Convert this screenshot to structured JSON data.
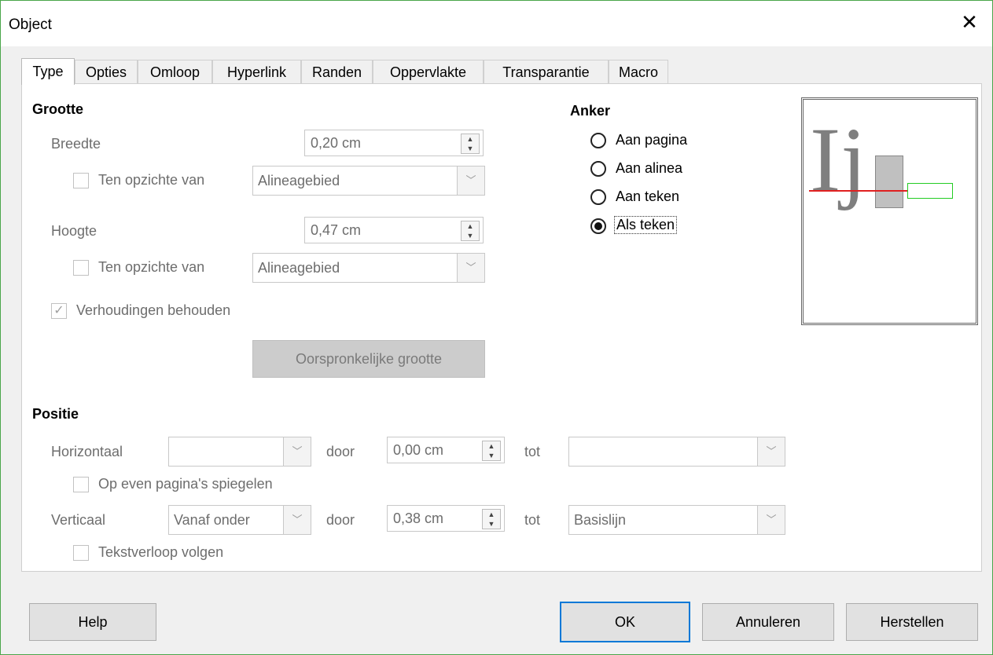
{
  "window": {
    "title": "Object"
  },
  "tabs": [
    {
      "label": "Type",
      "active": true
    },
    {
      "label": "Opties"
    },
    {
      "label": "Omloop"
    },
    {
      "label": "Hyperlink"
    },
    {
      "label": "Randen"
    },
    {
      "label": "Oppervlakte"
    },
    {
      "label": "Transparantie"
    },
    {
      "label": "Macro"
    }
  ],
  "size": {
    "heading": "Grootte",
    "width_label": "Breedte",
    "width_value": "0,20 cm",
    "width_relative_label": "Ten opzichte van",
    "width_relative_value": "Alineagebied",
    "height_label": "Hoogte",
    "height_value": "0,47 cm",
    "height_relative_label": "Ten opzichte van",
    "height_relative_value": "Alineagebied",
    "keep_ratio_label": "Verhoudingen behouden",
    "original_size_button": "Oorspronkelijke grootte"
  },
  "anchor": {
    "heading": "Anker",
    "options": [
      "Aan pagina",
      "Aan alinea",
      "Aan teken",
      "Als teken"
    ],
    "selected": "Als teken"
  },
  "preview": {
    "glyphs": "Ij"
  },
  "position": {
    "heading": "Positie",
    "horizontal_label": "Horizontaal",
    "horizontal_value": "",
    "horizontal_by_label": "door",
    "horizontal_by_value": "0,00 cm",
    "horizontal_to_label": "tot",
    "horizontal_to_value": "",
    "mirror_label": "Op even pagina's spiegelen",
    "vertical_label": "Verticaal",
    "vertical_value": "Vanaf onder",
    "vertical_by_label": "door",
    "vertical_by_value": "0,38 cm",
    "vertical_to_label": "tot",
    "vertical_to_value": "Basislijn",
    "follow_text_flow_label": "Tekstverloop volgen"
  },
  "buttons": {
    "help": "Help",
    "ok": "OK",
    "cancel": "Annuleren",
    "reset": "Herstellen"
  },
  "colors": {
    "accent": "#0078d7",
    "baseline_red": "#e02020",
    "frame_green": "#22cc22"
  }
}
